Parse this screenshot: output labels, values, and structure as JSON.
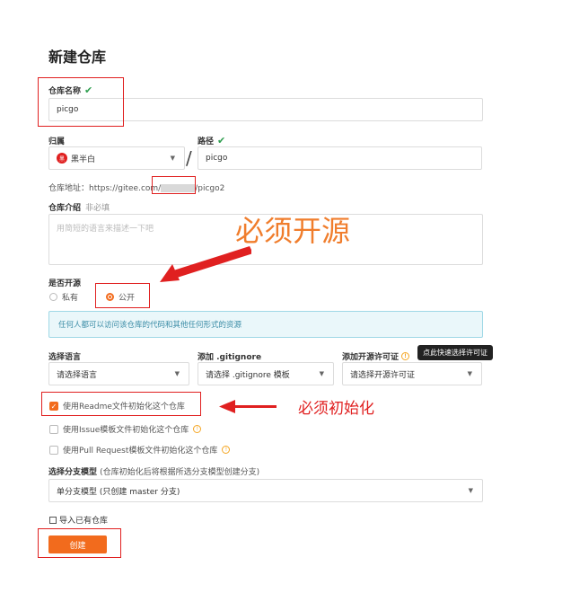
{
  "page_title": "新建仓库",
  "repo_name": {
    "label": "仓库名称",
    "check": "✔",
    "value": "picgo"
  },
  "owner": {
    "label": "归属",
    "avatar_text": "黑",
    "value": "黑半白"
  },
  "separator": "/",
  "path": {
    "label": "路径",
    "check": "✔",
    "value": "picgo"
  },
  "repo_url": {
    "label": "仓库地址：",
    "prefix": "https://gitee.com/",
    "suffix": "/picgo2"
  },
  "intro": {
    "label": "仓库介绍",
    "optional": "非必填",
    "placeholder": "用简短的语言来描述一下吧"
  },
  "annotation_open_source": "必须开源",
  "open_source": {
    "label": "是否开源",
    "options": [
      {
        "label": "私有",
        "selected": false
      },
      {
        "label": "公开",
        "selected": true
      }
    ],
    "notice": "任何人都可以访问该仓库的代码和其他任何形式的资源"
  },
  "language": {
    "label": "选择语言",
    "value": "请选择语言"
  },
  "gitignore": {
    "label": "添加 .gitignore",
    "value": "请选择 .gitignore 模板"
  },
  "license": {
    "label": "添加开源许可证",
    "value": "请选择开源许可证",
    "tooltip": "点此快速选择许可证"
  },
  "init_options": [
    {
      "label": "使用Readme文件初始化这个仓库",
      "checked": true
    },
    {
      "label": "使用Issue模板文件初始化这个仓库",
      "checked": false
    },
    {
      "label": "使用Pull Request模板文件初始化这个仓库",
      "checked": false
    }
  ],
  "annotation_init": "必须初始化",
  "branch_model": {
    "label": "选择分支模型",
    "hint": "(仓库初始化后将根据所选分支模型创建分支)",
    "value": "单分支模型 (只创建 master 分支)"
  },
  "import_link": "导入已有仓库",
  "create_button": "创建",
  "colors": {
    "accent": "#f26b1d",
    "annotation_red": "#e02020",
    "success": "#2e9e4f"
  }
}
